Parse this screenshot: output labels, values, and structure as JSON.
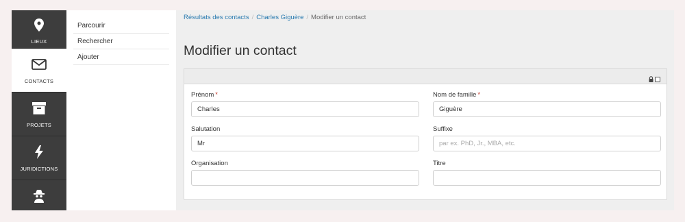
{
  "rail": {
    "items": [
      {
        "label": "LIEUX",
        "icon": "map-pin-icon",
        "active": false
      },
      {
        "label": "CONTACTS",
        "icon": "envelope-icon",
        "active": true
      },
      {
        "label": "PROJETS",
        "icon": "archive-box-icon",
        "active": false
      },
      {
        "label": "JURIDICTIONS",
        "icon": "lightning-icon",
        "active": false
      },
      {
        "label": "",
        "icon": "spy-icon",
        "active": false
      }
    ]
  },
  "submenu": {
    "items": [
      {
        "label": "Parcourir"
      },
      {
        "label": "Rechercher"
      },
      {
        "label": "Ajouter"
      }
    ]
  },
  "breadcrumb": {
    "results": "Résultats des contacts",
    "contact": "Charles Giguère",
    "current": "Modifier un contact",
    "separator": "/"
  },
  "page": {
    "title": "Modifier un contact"
  },
  "form": {
    "required_marker": "*",
    "first_name": {
      "label": "Prénom",
      "value": "Charles",
      "placeholder": ""
    },
    "last_name": {
      "label": "Nom de famille",
      "value": "Giguère",
      "placeholder": ""
    },
    "salutation": {
      "label": "Salutation",
      "value": "Mr",
      "placeholder": ""
    },
    "suffix": {
      "label": "Suffixe",
      "value": "",
      "placeholder": "par ex. PhD, Jr., MBA, etc."
    },
    "organisation": {
      "label": "Organisation",
      "value": "",
      "placeholder": ""
    },
    "title": {
      "label": "Titre",
      "value": "",
      "placeholder": ""
    }
  },
  "colors": {
    "rail_bg": "#3d3d3d",
    "link": "#2a7bb0",
    "required": "#c0392b"
  }
}
